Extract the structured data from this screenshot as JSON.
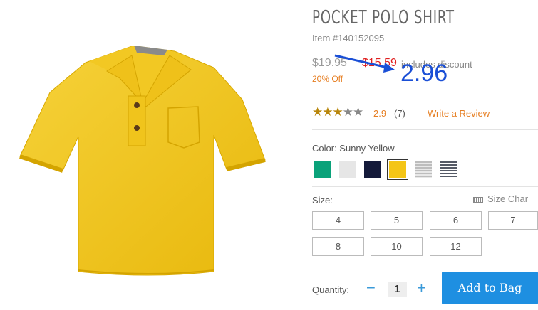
{
  "product": {
    "title": "POCKET POLO SHIRT",
    "item_number": "Item #140152095",
    "original_price": "$19.95",
    "sale_price": "$15.59",
    "discount_note": "includes discount",
    "percent_off": "20% Off"
  },
  "annotation": {
    "value": "2.96",
    "color": "#1a4fd6"
  },
  "rating": {
    "stars_filled": 3,
    "stars_total": 5,
    "value": "2.9",
    "count": "(7)",
    "write_review_label": "Write a Review"
  },
  "color": {
    "label": "Color: Sunny Yellow",
    "swatches": [
      {
        "name": "green",
        "color": "#0aa27a"
      },
      {
        "name": "white",
        "color": "#e6e6e6"
      },
      {
        "name": "navy",
        "color": "#141a3a"
      },
      {
        "name": "sunny-yellow",
        "color": "#f4c516",
        "selected": true
      },
      {
        "name": "gray-stripe",
        "color": "#bdbdbd"
      },
      {
        "name": "navy-stripe",
        "color": "#555a66"
      }
    ]
  },
  "size": {
    "label": "Size:",
    "chart_label": "Size Char",
    "options": [
      "4",
      "5",
      "6",
      "7",
      "8",
      "10",
      "12"
    ]
  },
  "quantity": {
    "label": "Quantity:",
    "minus": "−",
    "value": "1",
    "plus": "+"
  },
  "cart": {
    "add_label": "Add to Bag"
  }
}
